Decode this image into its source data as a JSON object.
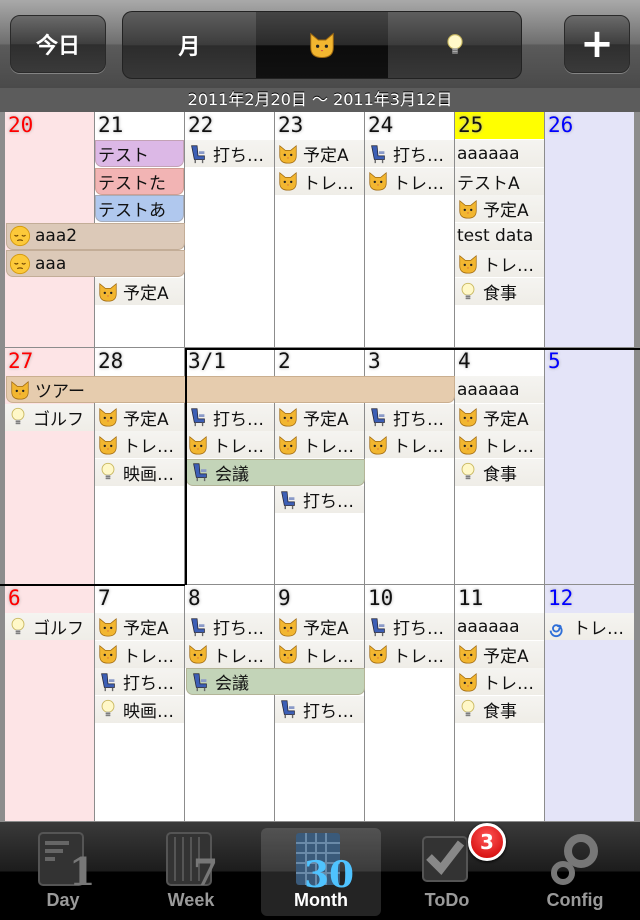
{
  "toolbar": {
    "today_label": "今日",
    "add_label": "+",
    "segments": [
      {
        "label": "月",
        "icon": "",
        "selected": false
      },
      {
        "label": "",
        "icon": "cat-face-icon",
        "selected": true
      },
      {
        "label": "",
        "icon": "light-bulb-icon",
        "selected": false
      }
    ]
  },
  "date_range": "2011年2月20日 〜 2011年3月12日",
  "today": "25",
  "colors": {
    "sunday_bg": "#fde4e6",
    "saturday_bg": "#e4e4f8",
    "today_bg": "#ffff00",
    "purple": "#dcb8e6",
    "pink": "#f2b4b4",
    "blue": "#b0c8ee",
    "tan": "#e6ccae",
    "green": "#c3d4b8",
    "brown": "#dcc9b8"
  },
  "weeks": [
    {
      "days": [
        "20",
        "21",
        "22",
        "23",
        "24",
        "25",
        "26"
      ],
      "events": [
        {
          "day": 1,
          "span": 1,
          "icon": "",
          "label": "テスト",
          "color": "purple"
        },
        {
          "day": 1,
          "span": 1,
          "icon": "",
          "label": "テストた",
          "color": "pink"
        },
        {
          "day": 1,
          "span": 1,
          "icon": "",
          "label": "テストあ",
          "color": "blue"
        },
        {
          "day": 0,
          "span": 2,
          "icon": "pensive-face-icon",
          "label": "aaa2",
          "color": "brown"
        },
        {
          "day": 0,
          "span": 2,
          "icon": "pensive-face-icon",
          "label": "aaa",
          "color": "brown"
        },
        {
          "day": 1,
          "span": 1,
          "icon": "cat-face-icon",
          "label": "予定A"
        },
        {
          "day": 2,
          "span": 1,
          "icon": "seat-icon",
          "label": "打ち…"
        },
        {
          "day": 3,
          "span": 1,
          "icon": "cat-face-icon",
          "label": "予定A"
        },
        {
          "day": 3,
          "span": 1,
          "icon": "cat-face-icon",
          "label": "トレ…"
        },
        {
          "day": 4,
          "span": 1,
          "icon": "seat-icon",
          "label": "打ち…"
        },
        {
          "day": 4,
          "span": 1,
          "icon": "cat-face-icon",
          "label": "トレ…"
        },
        {
          "day": 5,
          "span": 1,
          "icon": "",
          "label": "aaaaaa"
        },
        {
          "day": 5,
          "span": 1,
          "icon": "",
          "label": "テストA"
        },
        {
          "day": 5,
          "span": 1,
          "icon": "cat-face-icon",
          "label": "予定A"
        },
        {
          "day": 5,
          "span": 1,
          "icon": "",
          "label": "test data"
        },
        {
          "day": 5,
          "span": 1,
          "icon": "cat-face-icon",
          "label": "トレ…"
        },
        {
          "day": 5,
          "span": 1,
          "icon": "light-bulb-icon",
          "label": "食事"
        }
      ]
    },
    {
      "days": [
        "27",
        "28",
        "3/1",
        "2",
        "3",
        "4",
        "5"
      ],
      "events": [
        {
          "day": 0,
          "span": 5,
          "icon": "cat-face-icon",
          "label": "ツアー",
          "color": "tan"
        },
        {
          "day": 0,
          "span": 1,
          "icon": "light-bulb-icon",
          "label": "ゴルフ"
        },
        {
          "day": 1,
          "span": 1,
          "icon": "cat-face-icon",
          "label": "予定A"
        },
        {
          "day": 1,
          "span": 1,
          "icon": "cat-face-icon",
          "label": "トレ…"
        },
        {
          "day": 1,
          "span": 1,
          "icon": "light-bulb-icon",
          "label": "映画…"
        },
        {
          "day": 2,
          "span": 1,
          "icon": "seat-icon",
          "label": "打ち…"
        },
        {
          "day": 2,
          "span": 1,
          "icon": "cat-face-icon",
          "label": "トレ…"
        },
        {
          "day": 3,
          "span": 1,
          "icon": "cat-face-icon",
          "label": "予定A"
        },
        {
          "day": 3,
          "span": 1,
          "icon": "cat-face-icon",
          "label": "トレ…"
        },
        {
          "day": 2,
          "span": 2,
          "icon": "seat-icon",
          "label": "会議",
          "color": "green"
        },
        {
          "day": 3,
          "span": 1,
          "icon": "seat-icon",
          "label": "打ち…"
        },
        {
          "day": 4,
          "span": 1,
          "icon": "seat-icon",
          "label": "打ち…"
        },
        {
          "day": 4,
          "span": 1,
          "icon": "cat-face-icon",
          "label": "トレ…"
        },
        {
          "day": 5,
          "span": 1,
          "icon": "",
          "label": "aaaaaa"
        },
        {
          "day": 5,
          "span": 1,
          "icon": "cat-face-icon",
          "label": "予定A"
        },
        {
          "day": 5,
          "span": 1,
          "icon": "cat-face-icon",
          "label": "トレ…"
        },
        {
          "day": 5,
          "span": 1,
          "icon": "light-bulb-icon",
          "label": "食事"
        }
      ]
    },
    {
      "days": [
        "6",
        "7",
        "8",
        "9",
        "10",
        "11",
        "12"
      ],
      "events": [
        {
          "day": 0,
          "span": 1,
          "icon": "light-bulb-icon",
          "label": "ゴルフ"
        },
        {
          "day": 1,
          "span": 1,
          "icon": "cat-face-icon",
          "label": "予定A"
        },
        {
          "day": 1,
          "span": 1,
          "icon": "cat-face-icon",
          "label": "トレ…"
        },
        {
          "day": 1,
          "span": 1,
          "icon": "seat-icon",
          "label": "打ち…"
        },
        {
          "day": 1,
          "span": 1,
          "icon": "light-bulb-icon",
          "label": "映画…"
        },
        {
          "day": 2,
          "span": 1,
          "icon": "seat-icon",
          "label": "打ち…"
        },
        {
          "day": 2,
          "span": 1,
          "icon": "cat-face-icon",
          "label": "トレ…"
        },
        {
          "day": 3,
          "span": 1,
          "icon": "cat-face-icon",
          "label": "予定A"
        },
        {
          "day": 3,
          "span": 1,
          "icon": "cat-face-icon",
          "label": "トレ…"
        },
        {
          "day": 2,
          "span": 2,
          "icon": "seat-icon",
          "label": "会議",
          "color": "green"
        },
        {
          "day": 3,
          "span": 1,
          "icon": "seat-icon",
          "label": "打ち…"
        },
        {
          "day": 4,
          "span": 1,
          "icon": "seat-icon",
          "label": "打ち…"
        },
        {
          "day": 4,
          "span": 1,
          "icon": "cat-face-icon",
          "label": "トレ…"
        },
        {
          "day": 5,
          "span": 1,
          "icon": "",
          "label": "aaaaaa"
        },
        {
          "day": 5,
          "span": 1,
          "icon": "cat-face-icon",
          "label": "予定A"
        },
        {
          "day": 5,
          "span": 1,
          "icon": "cat-face-icon",
          "label": "トレ…"
        },
        {
          "day": 5,
          "span": 1,
          "icon": "light-bulb-icon",
          "label": "食事"
        },
        {
          "day": 6,
          "span": 1,
          "icon": "cyclone-icon",
          "label": "トレ…"
        }
      ]
    }
  ],
  "tabs": [
    {
      "label": "Day",
      "icon": "day-icon",
      "selected": false
    },
    {
      "label": "Week",
      "icon": "week-icon",
      "selected": false
    },
    {
      "label": "Month",
      "icon": "month-icon",
      "selected": true
    },
    {
      "label": "ToDo",
      "icon": "todo-check-icon",
      "selected": false
    },
    {
      "label": "Config",
      "icon": "gear-icon",
      "selected": false
    }
  ],
  "todo_badge": "3"
}
